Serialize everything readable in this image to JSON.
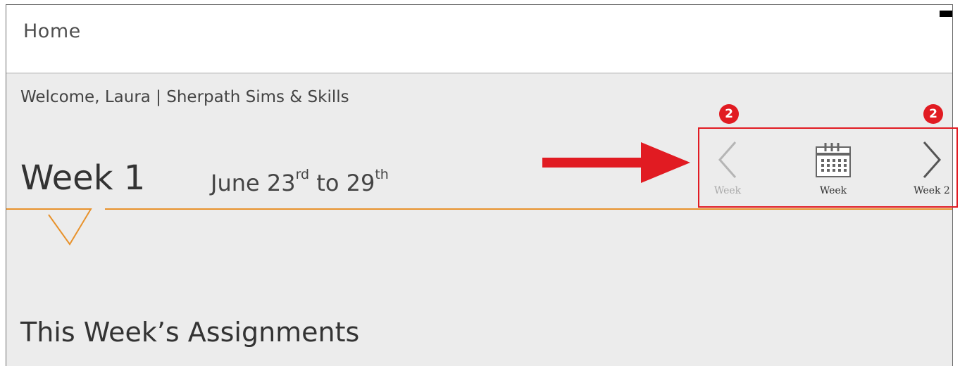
{
  "header": {
    "title": "Home"
  },
  "welcome": {
    "text": "Welcome, Laura | Sherpath Sims & Skills"
  },
  "week": {
    "title": "Week 1",
    "date_prefix": "June 23",
    "date_start_suffix": "rd",
    "date_middle": " to 29",
    "date_end_suffix": "th"
  },
  "nav": {
    "prev_label": "Week",
    "calendar_label": "Week",
    "next_label": "Week 2"
  },
  "badges": {
    "prev_badge": "2",
    "next_badge": "2"
  },
  "assignments": {
    "title": "This Week’s Assignments"
  },
  "colors": {
    "accent": "#e8922c",
    "annotation": "#e11b22",
    "background": "#ececec"
  },
  "icons": [
    "chevron-left-icon",
    "calendar-icon",
    "chevron-right-icon",
    "red-arrow-icon"
  ]
}
